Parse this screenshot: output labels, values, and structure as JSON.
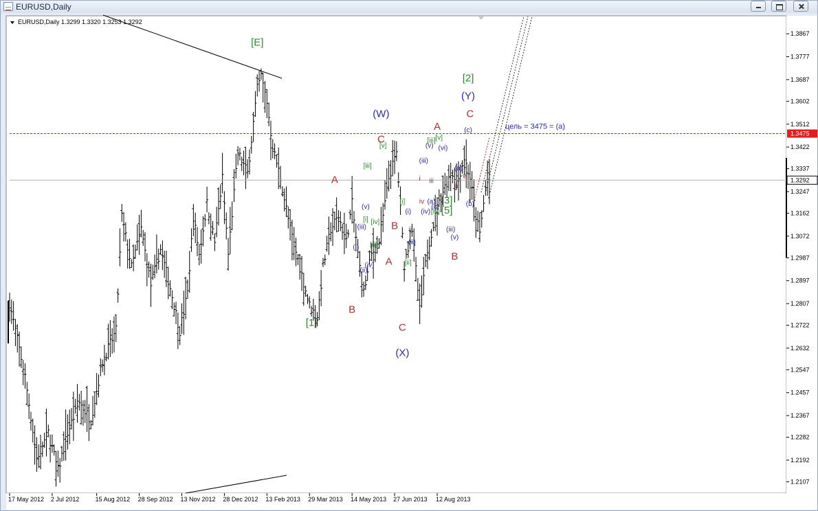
{
  "window": {
    "title": "EURUSD,Daily"
  },
  "chart_data": {
    "type": "bar",
    "symbol_header": "EURUSD,Daily  1.3299 1.3320 1.3253 1.3292",
    "ylim": [
      1.2065,
      1.3935
    ],
    "y_ticks": [
      1.3867,
      1.3777,
      1.3687,
      1.3602,
      1.3512,
      1.3422,
      1.3337,
      1.3247,
      1.3162,
      1.3072,
      1.2987,
      1.2897,
      1.2807,
      1.2722,
      1.2632,
      1.2547,
      1.2457,
      1.2367,
      1.2282,
      1.2192,
      1.2107
    ],
    "x_ticks": [
      "17 May 2012",
      "2 Jul 2012",
      "15 Aug 2012",
      "28 Sep 2012",
      "13 Nov 2012",
      "28 Dec 2012",
      "13 Feb 2013",
      "29 Mar 2013",
      "14 May 2013",
      "27 Jun 2013",
      "12 Aug 2013"
    ],
    "current_price": 1.3292,
    "target_level": {
      "value": 1.3475,
      "label": "1.3475",
      "annotation": "цель = 3475 = (a)"
    },
    "anchors": [
      [
        0,
        1.281
      ],
      [
        8,
        1.252
      ],
      [
        14,
        1.22
      ],
      [
        20,
        1.23
      ],
      [
        25,
        1.215
      ],
      [
        30,
        1.23
      ],
      [
        36,
        1.242
      ],
      [
        42,
        1.235
      ],
      [
        48,
        1.258
      ],
      [
        55,
        1.27
      ],
      [
        58,
        1.315
      ],
      [
        63,
        1.295
      ],
      [
        68,
        1.31
      ],
      [
        73,
        1.288
      ],
      [
        78,
        1.302
      ],
      [
        83,
        1.287
      ],
      [
        88,
        1.27
      ],
      [
        92,
        1.285
      ],
      [
        95,
        1.315
      ],
      [
        98,
        1.3
      ],
      [
        102,
        1.32
      ],
      [
        106,
        1.305
      ],
      [
        110,
        1.33
      ],
      [
        113,
        1.3
      ],
      [
        118,
        1.34
      ],
      [
        123,
        1.332
      ],
      [
        128,
        1.365
      ],
      [
        130,
        1.37
      ],
      [
        133,
        1.36
      ],
      [
        136,
        1.342
      ],
      [
        140,
        1.33
      ],
      [
        145,
        1.31
      ],
      [
        150,
        1.295
      ],
      [
        155,
        1.28
      ],
      [
        159,
        1.275
      ],
      [
        162,
        1.295
      ],
      [
        166,
        1.31
      ],
      [
        170,
        1.315
      ],
      [
        174,
        1.305
      ],
      [
        177,
        1.32
      ],
      [
        180,
        1.3
      ],
      [
        183,
        1.285
      ],
      [
        187,
        1.3
      ],
      [
        191,
        1.305
      ],
      [
        196,
        1.33
      ],
      [
        200,
        1.34
      ],
      [
        204,
        1.296
      ],
      [
        208,
        1.31
      ],
      [
        212,
        1.278
      ],
      [
        216,
        1.302
      ],
      [
        220,
        1.315
      ],
      [
        224,
        1.325
      ],
      [
        228,
        1.332
      ],
      [
        232,
        1.33
      ],
      [
        235,
        1.338
      ],
      [
        238,
        1.33
      ],
      [
        241,
        1.315
      ],
      [
        243,
        1.308
      ],
      [
        245,
        1.32
      ],
      [
        247,
        1.332
      ],
      [
        248,
        1.3292
      ]
    ],
    "bar_count": 249,
    "wave_labels": [
      {
        "text": "[E]",
        "x": 128,
        "y": 1.382,
        "color": "#2e8b2e"
      },
      {
        "text": "[1]",
        "x": 156,
        "y": 1.272,
        "color": "#2e8b2e"
      },
      {
        "text": "A",
        "x": 168,
        "y": 1.328,
        "color": "#b03030"
      },
      {
        "text": "B",
        "x": 177,
        "y": 1.277,
        "color": "#b03030"
      },
      {
        "text": "(W)",
        "x": 192,
        "y": 1.354,
        "color": "#2a2ab0"
      },
      {
        "text": "C",
        "x": 192,
        "y": 1.344,
        "color": "#b03030"
      },
      {
        "text": "A",
        "x": 196,
        "y": 1.296,
        "color": "#b03030"
      },
      {
        "text": "B",
        "x": 199,
        "y": 1.31,
        "color": "#b03030"
      },
      {
        "text": "C",
        "x": 203,
        "y": 1.27,
        "color": "#b03030"
      },
      {
        "text": "(X)",
        "x": 203,
        "y": 1.26,
        "color": "#2a2ab0"
      },
      {
        "text": "A",
        "x": 221,
        "y": 1.349,
        "color": "#b03030"
      },
      {
        "text": "B",
        "x": 230,
        "y": 1.298,
        "color": "#b03030"
      },
      {
        "text": "[2]",
        "x": 237,
        "y": 1.368,
        "color": "#2e8b2e"
      },
      {
        "text": "(Y)",
        "x": 237,
        "y": 1.361,
        "color": "#2a2ab0"
      },
      {
        "text": "C",
        "x": 238,
        "y": 1.354,
        "color": "#b03030"
      },
      {
        "text": "(c)",
        "x": 237,
        "y": 1.348,
        "color": "#2a2ab0"
      },
      {
        "text": "(a)",
        "x": 232,
        "y": 1.333,
        "color": "#2a2ab0"
      },
      {
        "text": "(b)",
        "x": 238,
        "y": 1.319,
        "color": "#2a2ab0"
      },
      {
        "text": "(i)",
        "x": 179,
        "y": 1.302,
        "color": "#2a2ab0"
      },
      {
        "text": "(ii)",
        "x": 183,
        "y": 1.293,
        "color": "#2a2ab0"
      },
      {
        "text": "(iii)",
        "x": 182,
        "y": 1.31,
        "color": "#2a2ab0"
      },
      {
        "text": "(iv)",
        "x": 186,
        "y": 1.295,
        "color": "#2a2ab0"
      },
      {
        "text": "(v)",
        "x": 184,
        "y": 1.318,
        "color": "#2a2ab0"
      },
      {
        "text": "[i]",
        "x": 184,
        "y": 1.313,
        "color": "#2e8b2e"
      },
      {
        "text": "[ii]",
        "x": 188,
        "y": 1.303,
        "color": "#2e8b2e"
      },
      {
        "text": "[iii]",
        "x": 185,
        "y": 1.334,
        "color": "#2e8b2e"
      },
      {
        "text": "[iv]",
        "x": 189,
        "y": 1.312,
        "color": "#2e8b2e"
      },
      {
        "text": "[v]",
        "x": 193,
        "y": 1.342,
        "color": "#2e8b2e"
      },
      {
        "text": "[i]",
        "x": 203,
        "y": 1.32,
        "color": "#2e8b2e"
      },
      {
        "text": "[ii]",
        "x": 206,
        "y": 1.296,
        "color": "#2e8b2e"
      },
      {
        "text": "ii",
        "x": 207,
        "y": 1.309,
        "color": "#b03030"
      },
      {
        "text": "(i)",
        "x": 206,
        "y": 1.316,
        "color": "#2a2ab0"
      },
      {
        "text": "(ii)",
        "x": 208,
        "y": 1.304,
        "color": "#2a2ab0"
      },
      {
        "text": "(iii)",
        "x": 214,
        "y": 1.336,
        "color": "#2a2ab0"
      },
      {
        "text": "(iv)",
        "x": 215,
        "y": 1.316,
        "color": "#2a2ab0"
      },
      {
        "text": "(v)",
        "x": 217,
        "y": 1.342,
        "color": "#2a2ab0"
      },
      {
        "text": "[iii]",
        "x": 218,
        "y": 1.344,
        "color": "#2e8b2e"
      },
      {
        "text": "[v]",
        "x": 222,
        "y": 1.345,
        "color": "#2e8b2e"
      },
      {
        "text": "[iv]",
        "x": 220,
        "y": 1.316,
        "color": "#2e8b2e"
      },
      {
        "text": "(a)",
        "x": 218,
        "y": 1.32,
        "color": "#2a2ab0"
      },
      {
        "text": "(c)",
        "x": 220,
        "y": 1.318,
        "color": "#2a2ab0"
      },
      {
        "text": "(vi)",
        "x": 224,
        "y": 1.341,
        "color": "#2a2ab0"
      },
      {
        "text": "iii",
        "x": 218,
        "y": 1.328,
        "color": "#b03030"
      },
      {
        "text": "iv",
        "x": 213,
        "y": 1.32,
        "color": "#b03030"
      },
      {
        "text": "i",
        "x": 212,
        "y": 1.329,
        "color": "#b03030"
      },
      {
        "text": "(iii)",
        "x": 228,
        "y": 1.309,
        "color": "#2a2ab0"
      },
      {
        "text": "(v)",
        "x": 230,
        "y": 1.306,
        "color": "#2a2ab0"
      },
      {
        "text": "[5]",
        "x": 226,
        "y": 1.316,
        "color": "#2e8b2e"
      },
      {
        "text": "[3]",
        "x": 226,
        "y": 1.32,
        "color": "#2e8b2e"
      },
      {
        "text": "v",
        "x": 235,
        "y": 1.33,
        "color": "#b03030"
      },
      {
        "text": "ii",
        "x": 231,
        "y": 1.326,
        "color": "#b03030"
      }
    ]
  }
}
